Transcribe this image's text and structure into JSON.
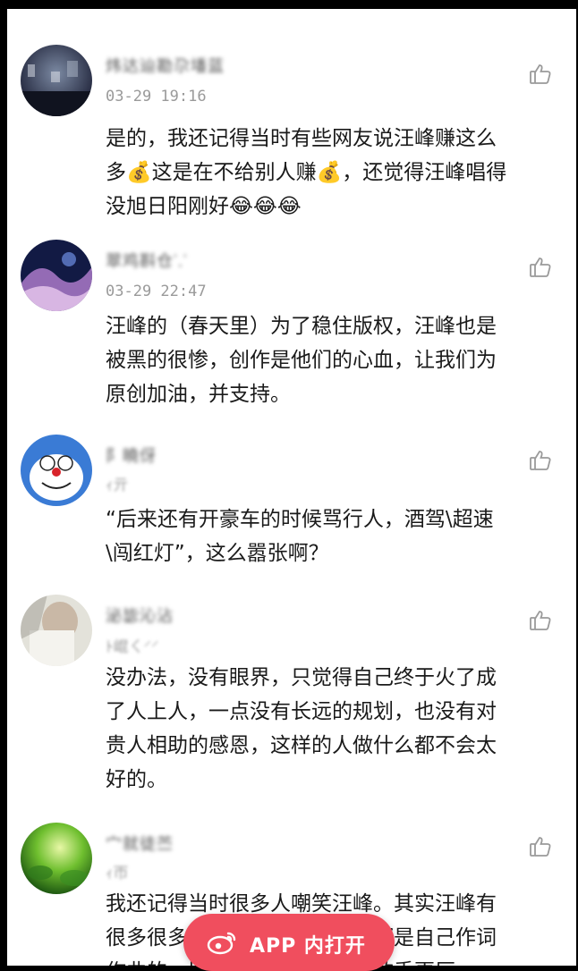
{
  "comments": [
    {
      "username": "炜达辿勘尕墦蓝",
      "meta": "03-29 19:16",
      "lines": [
        "是的，我还记得当时有些网友说汪峰赚这么",
        "多💰这是在不给别人赚💰，还觉得汪峰唱得",
        "没旭日阳刚好😂😂😂"
      ],
      "avatar_colors": [
        "#2b2f4a",
        "#6d7487"
      ]
    },
    {
      "username": "翠鸡斟仓⸪",
      "meta": "03-29 22:47",
      "lines": [
        "汪峰的（春天里）为了稳住版权，汪峰也是",
        "被黑的很惨，创作是他们的心血，让我们为",
        "原创加油，并支持。"
      ],
      "avatar_colors": [
        "#18204f",
        "#c7a0d8"
      ]
    },
    {
      "username": "阝曉伢",
      "meta": "ｨ亓",
      "lines": [
        "“后来还有开豪车的时候骂行人，酒驾\\超速",
        "\\闯红灯”，这么嚣张啊？"
      ],
      "avatar_colors": [
        "#3a7bd5",
        "#ffffff"
      ]
    },
    {
      "username": "泌毖沁沾",
      "meta": "ﾄ崐ㄑ⸍⸍",
      "lines": [
        "没办法，没有眼界，只觉得自己终于火了成",
        "了人上人，一点没有长远的规划，也没有对",
        "贵人相助的感恩，这样的人做什么都不会太",
        "好的。"
      ],
      "avatar_colors": [
        "#d6d6cc",
        "#8a8a80"
      ]
    },
    {
      "username": "宀就徒苎",
      "meta": "ｨ帀",
      "lines": [
        "我还记得当时很多人嘲笑汪峰。其实汪峰有",
        "很多很多很好听的歌曲，而且都是自己作词",
        "作曲的，比那些普通的普通的歌手更厉"
      ],
      "avatar_colors": [
        "#2f7a1c",
        "#b7e36b"
      ]
    }
  ],
  "app_button": {
    "label": "APP 内打开",
    "color": "#f04e5e"
  }
}
